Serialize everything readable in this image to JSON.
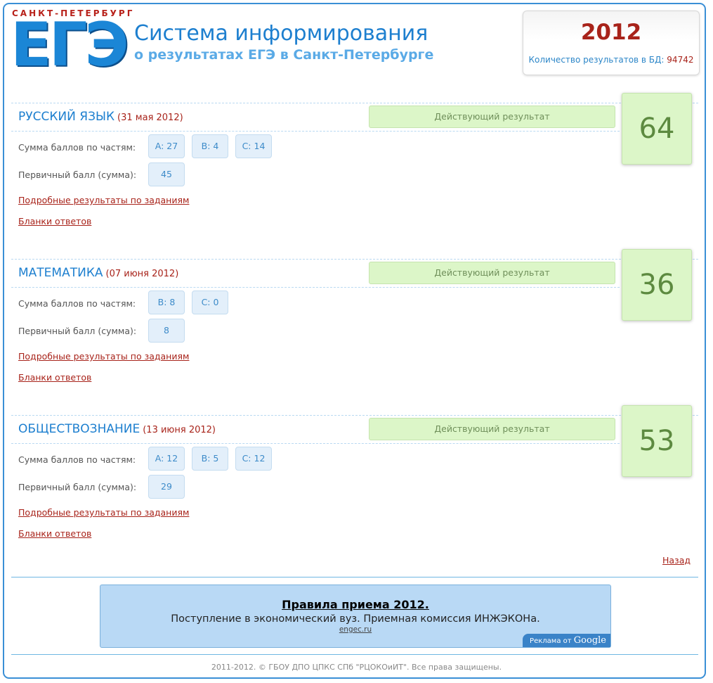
{
  "header": {
    "logo_city": "САНКТ-ПЕТЕРБУРГ",
    "logo_text": "ЕГЭ",
    "title": "Система информирования",
    "subtitle": "о результатах ЕГЭ в Санкт-Петербурге",
    "year": "2012",
    "db_label": "Количество результатов в БД:",
    "db_count": "94742"
  },
  "labels": {
    "parts": "Сумма баллов по частям:",
    "primary": "Первичный балл (сумма):",
    "details_link": "Подробные результаты по заданиям",
    "blanks_link": "Бланки ответов"
  },
  "exams": [
    {
      "subject": "РУССКИЙ ЯЗЫК",
      "date": "(31 мая 2012)",
      "status": "Действующий результат",
      "score": "64",
      "parts": [
        "A: 27",
        "B: 4",
        "C: 14"
      ],
      "primary": "45"
    },
    {
      "subject": "МАТЕМАТИКА",
      "date": "(07 июня 2012)",
      "status": "Действующий результат",
      "score": "36",
      "parts": [
        "B: 8",
        "C: 0"
      ],
      "primary": "8"
    },
    {
      "subject": "ОБЩЕСТВОЗНАНИЕ",
      "date": "(13 июня 2012)",
      "status": "Действующий результат",
      "score": "53",
      "parts": [
        "A: 12",
        "B: 5",
        "C: 12"
      ],
      "primary": "29"
    }
  ],
  "nav": {
    "back": "Назад"
  },
  "ad": {
    "title": "Правила приема 2012.",
    "text": "Поступление в экономический вуз. Приемная комиссия ИНЖЭКОНа.",
    "url": "engec.ru",
    "badge_prefix": "Реклама от",
    "badge_brand": "Google"
  },
  "footer": {
    "text": "2011-2012. © ГБОУ ДПО ЦПКС СПб \"РЦОКОиИТ\". Все права защищены."
  }
}
